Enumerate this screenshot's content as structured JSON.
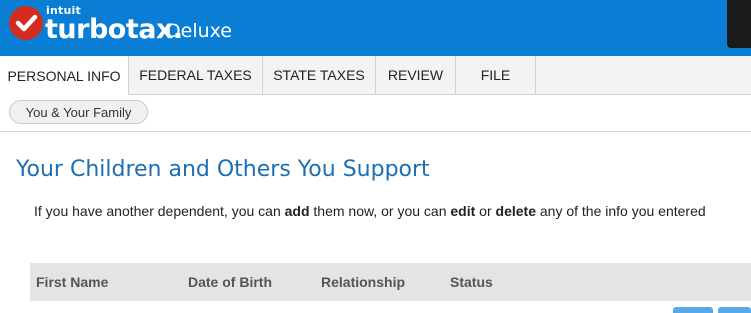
{
  "header": {
    "brand_parent": "intuit",
    "brand_name": "turbotax.",
    "edition": "Deluxe",
    "colors": {
      "bar": "#0a7ed5",
      "logo_check": "#d52b1e"
    }
  },
  "tabs": [
    {
      "label": "PERSONAL INFO",
      "active": true
    },
    {
      "label": "FEDERAL TAXES",
      "active": false
    },
    {
      "label": "STATE TAXES",
      "active": false
    },
    {
      "label": "REVIEW",
      "active": false
    },
    {
      "label": "FILE",
      "active": false
    }
  ],
  "breadcrumb": {
    "label": "You & Your Family"
  },
  "main": {
    "title": "Your Children and Others You Support",
    "instructions": {
      "part1": "If you have another dependent, you can ",
      "add": "add",
      "part2": " them now, or you can ",
      "edit": "edit",
      "part3": " or ",
      "delete": "delete",
      "part4": " any of the info you entered"
    },
    "table": {
      "columns": [
        "First Name",
        "Date of Birth",
        "Relationship",
        "Status"
      ]
    }
  }
}
